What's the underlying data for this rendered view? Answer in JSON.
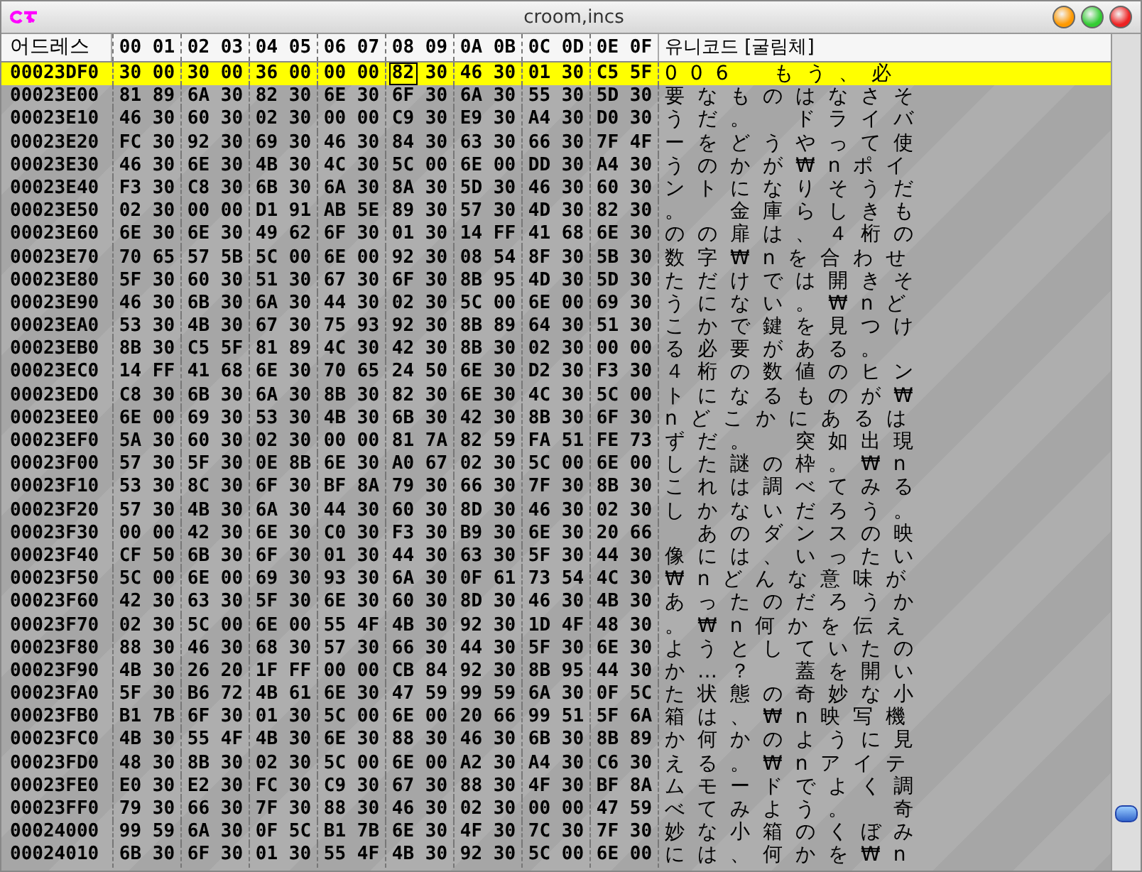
{
  "window": {
    "title": "croom,incs"
  },
  "columns": {
    "address": "어드레스",
    "bytes": [
      "00",
      "01",
      "02",
      "03",
      "04",
      "05",
      "06",
      "07",
      "08",
      "09",
      "0A",
      "0B",
      "0C",
      "0D",
      "0E",
      "0F"
    ],
    "text": "유니코드 [굴림체]"
  },
  "rows": [
    {
      "address": "00023DF0",
      "bytes": [
        "30",
        "00",
        "30",
        "00",
        "36",
        "00",
        "00",
        "00",
        "82",
        "30",
        "46",
        "30",
        "01",
        "30",
        "C5",
        "5F"
      ],
      "text": "006　もう、必",
      "selected": true,
      "cursor": [
        false,
        false,
        false,
        false,
        false,
        false,
        false,
        false,
        true,
        false,
        false,
        false,
        false,
        false,
        false,
        false
      ]
    },
    {
      "address": "00023E00",
      "bytes": [
        "81",
        "89",
        "6A",
        "30",
        "82",
        "30",
        "6E",
        "30",
        "6F",
        "30",
        "6A",
        "30",
        "55",
        "30",
        "5D",
        "30"
      ],
      "text": "要なものはなさそ",
      "selected": false
    },
    {
      "address": "00023E10",
      "bytes": [
        "46",
        "30",
        "60",
        "30",
        "02",
        "30",
        "00",
        "00",
        "C9",
        "30",
        "E9",
        "30",
        "A4",
        "30",
        "D0",
        "30"
      ],
      "text": "うだ。　ドライバ",
      "selected": false
    },
    {
      "address": "00023E20",
      "bytes": [
        "FC",
        "30",
        "92",
        "30",
        "69",
        "30",
        "46",
        "30",
        "84",
        "30",
        "63",
        "30",
        "66",
        "30",
        "7F",
        "4F"
      ],
      "text": "ーをどうやって使",
      "selected": false
    },
    {
      "address": "00023E30",
      "bytes": [
        "46",
        "30",
        "6E",
        "30",
        "4B",
        "30",
        "4C",
        "30",
        "5C",
        "00",
        "6E",
        "00",
        "DD",
        "30",
        "A4",
        "30"
      ],
      "text": "うのかが₩nポイ",
      "selected": false
    },
    {
      "address": "00023E40",
      "bytes": [
        "F3",
        "30",
        "C8",
        "30",
        "6B",
        "30",
        "6A",
        "30",
        "8A",
        "30",
        "5D",
        "30",
        "46",
        "30",
        "60",
        "30"
      ],
      "text": "ントになりそうだ",
      "selected": false
    },
    {
      "address": "00023E50",
      "bytes": [
        "02",
        "30",
        "00",
        "00",
        "D1",
        "91",
        "AB",
        "5E",
        "89",
        "30",
        "57",
        "30",
        "4D",
        "30",
        "82",
        "30"
      ],
      "text": "。　金庫らしきも",
      "selected": false
    },
    {
      "address": "00023E60",
      "bytes": [
        "6E",
        "30",
        "6E",
        "30",
        "49",
        "62",
        "6F",
        "30",
        "01",
        "30",
        "14",
        "FF",
        "41",
        "68",
        "6E",
        "30"
      ],
      "text": "のの扉は、４桁の",
      "selected": false
    },
    {
      "address": "00023E70",
      "bytes": [
        "70",
        "65",
        "57",
        "5B",
        "5C",
        "00",
        "6E",
        "00",
        "92",
        "30",
        "08",
        "54",
        "8F",
        "30",
        "5B",
        "30"
      ],
      "text": "数字₩nを合わせ",
      "selected": false
    },
    {
      "address": "00023E80",
      "bytes": [
        "5F",
        "30",
        "60",
        "30",
        "51",
        "30",
        "67",
        "30",
        "6F",
        "30",
        "8B",
        "95",
        "4D",
        "30",
        "5D",
        "30"
      ],
      "text": "ただけでは開きそ",
      "selected": false
    },
    {
      "address": "00023E90",
      "bytes": [
        "46",
        "30",
        "6B",
        "30",
        "6A",
        "30",
        "44",
        "30",
        "02",
        "30",
        "5C",
        "00",
        "6E",
        "00",
        "69",
        "30"
      ],
      "text": "うにない。₩nど",
      "selected": false
    },
    {
      "address": "00023EA0",
      "bytes": [
        "53",
        "30",
        "4B",
        "30",
        "67",
        "30",
        "75",
        "93",
        "92",
        "30",
        "8B",
        "89",
        "64",
        "30",
        "51",
        "30"
      ],
      "text": "こかで鍵を見つけ",
      "selected": false
    },
    {
      "address": "00023EB0",
      "bytes": [
        "8B",
        "30",
        "C5",
        "5F",
        "81",
        "89",
        "4C",
        "30",
        "42",
        "30",
        "8B",
        "30",
        "02",
        "30",
        "00",
        "00"
      ],
      "text": "る必要がある。",
      "selected": false
    },
    {
      "address": "00023EC0",
      "bytes": [
        "14",
        "FF",
        "41",
        "68",
        "6E",
        "30",
        "70",
        "65",
        "24",
        "50",
        "6E",
        "30",
        "D2",
        "30",
        "F3",
        "30"
      ],
      "text": "４桁の数値のヒン",
      "selected": false
    },
    {
      "address": "00023ED0",
      "bytes": [
        "C8",
        "30",
        "6B",
        "30",
        "6A",
        "30",
        "8B",
        "30",
        "82",
        "30",
        "6E",
        "30",
        "4C",
        "30",
        "5C",
        "00"
      ],
      "text": "トになるものが₩",
      "selected": false
    },
    {
      "address": "00023EE0",
      "bytes": [
        "6E",
        "00",
        "69",
        "30",
        "53",
        "30",
        "4B",
        "30",
        "6B",
        "30",
        "42",
        "30",
        "8B",
        "30",
        "6F",
        "30"
      ],
      "text": "nどこかにあるは",
      "selected": false
    },
    {
      "address": "00023EF0",
      "bytes": [
        "5A",
        "30",
        "60",
        "30",
        "02",
        "30",
        "00",
        "00",
        "81",
        "7A",
        "82",
        "59",
        "FA",
        "51",
        "FE",
        "73"
      ],
      "text": "ずだ。　突如出現",
      "selected": false
    },
    {
      "address": "00023F00",
      "bytes": [
        "57",
        "30",
        "5F",
        "30",
        "0E",
        "8B",
        "6E",
        "30",
        "A0",
        "67",
        "02",
        "30",
        "5C",
        "00",
        "6E",
        "00"
      ],
      "text": "した謎の枠。₩n",
      "selected": false
    },
    {
      "address": "00023F10",
      "bytes": [
        "53",
        "30",
        "8C",
        "30",
        "6F",
        "30",
        "BF",
        "8A",
        "79",
        "30",
        "66",
        "30",
        "7F",
        "30",
        "8B",
        "30"
      ],
      "text": "これは調べてみる",
      "selected": false
    },
    {
      "address": "00023F20",
      "bytes": [
        "57",
        "30",
        "4B",
        "30",
        "6A",
        "30",
        "44",
        "30",
        "60",
        "30",
        "8D",
        "30",
        "46",
        "30",
        "02",
        "30"
      ],
      "text": "しかないだろう。",
      "selected": false
    },
    {
      "address": "00023F30",
      "bytes": [
        "00",
        "00",
        "42",
        "30",
        "6E",
        "30",
        "C0",
        "30",
        "F3",
        "30",
        "B9",
        "30",
        "6E",
        "30",
        "20",
        "66"
      ],
      "text": "　あのダンスの映",
      "selected": false
    },
    {
      "address": "00023F40",
      "bytes": [
        "CF",
        "50",
        "6B",
        "30",
        "6F",
        "30",
        "01",
        "30",
        "44",
        "30",
        "63",
        "30",
        "5F",
        "30",
        "44",
        "30"
      ],
      "text": "像には、いったい",
      "selected": false
    },
    {
      "address": "00023F50",
      "bytes": [
        "5C",
        "00",
        "6E",
        "00",
        "69",
        "30",
        "93",
        "30",
        "6A",
        "30",
        "0F",
        "61",
        "73",
        "54",
        "4C",
        "30"
      ],
      "text": "₩nどんな意味が",
      "selected": false
    },
    {
      "address": "00023F60",
      "bytes": [
        "42",
        "30",
        "63",
        "30",
        "5F",
        "30",
        "6E",
        "30",
        "60",
        "30",
        "8D",
        "30",
        "46",
        "30",
        "4B",
        "30"
      ],
      "text": "あったのだろうか",
      "selected": false
    },
    {
      "address": "00023F70",
      "bytes": [
        "02",
        "30",
        "5C",
        "00",
        "6E",
        "00",
        "55",
        "4F",
        "4B",
        "30",
        "92",
        "30",
        "1D",
        "4F",
        "48",
        "30"
      ],
      "text": "。₩n何かを伝え",
      "selected": false
    },
    {
      "address": "00023F80",
      "bytes": [
        "88",
        "30",
        "46",
        "30",
        "68",
        "30",
        "57",
        "30",
        "66",
        "30",
        "44",
        "30",
        "5F",
        "30",
        "6E",
        "30"
      ],
      "text": "ようとしていたの",
      "selected": false
    },
    {
      "address": "00023F90",
      "bytes": [
        "4B",
        "30",
        "26",
        "20",
        "1F",
        "FF",
        "00",
        "00",
        "CB",
        "84",
        "92",
        "30",
        "8B",
        "95",
        "44",
        "30"
      ],
      "text": "か…？　蓋を開い",
      "selected": false
    },
    {
      "address": "00023FA0",
      "bytes": [
        "5F",
        "30",
        "B6",
        "72",
        "4B",
        "61",
        "6E",
        "30",
        "47",
        "59",
        "99",
        "59",
        "6A",
        "30",
        "0F",
        "5C"
      ],
      "text": "た状態の奇妙な小",
      "selected": false
    },
    {
      "address": "00023FB0",
      "bytes": [
        "B1",
        "7B",
        "6F",
        "30",
        "01",
        "30",
        "5C",
        "00",
        "6E",
        "00",
        "20",
        "66",
        "99",
        "51",
        "5F",
        "6A"
      ],
      "text": "箱は、₩n映写機",
      "selected": false
    },
    {
      "address": "00023FC0",
      "bytes": [
        "4B",
        "30",
        "55",
        "4F",
        "4B",
        "30",
        "6E",
        "30",
        "88",
        "30",
        "46",
        "30",
        "6B",
        "30",
        "8B",
        "89"
      ],
      "text": "か何かのように見",
      "selected": false
    },
    {
      "address": "00023FD0",
      "bytes": [
        "48",
        "30",
        "8B",
        "30",
        "02",
        "30",
        "5C",
        "00",
        "6E",
        "00",
        "A2",
        "30",
        "A4",
        "30",
        "C6",
        "30"
      ],
      "text": "える。₩nアイテ",
      "selected": false
    },
    {
      "address": "00023FE0",
      "bytes": [
        "E0",
        "30",
        "E2",
        "30",
        "FC",
        "30",
        "C9",
        "30",
        "67",
        "30",
        "88",
        "30",
        "4F",
        "30",
        "BF",
        "8A"
      ],
      "text": "ムモードでよく調",
      "selected": false
    },
    {
      "address": "00023FF0",
      "bytes": [
        "79",
        "30",
        "66",
        "30",
        "7F",
        "30",
        "88",
        "30",
        "46",
        "30",
        "02",
        "30",
        "00",
        "00",
        "47",
        "59"
      ],
      "text": "べてみよう。　奇",
      "selected": false
    },
    {
      "address": "00024000",
      "bytes": [
        "99",
        "59",
        "6A",
        "30",
        "0F",
        "5C",
        "B1",
        "7B",
        "6E",
        "30",
        "4F",
        "30",
        "7C",
        "30",
        "7F",
        "30"
      ],
      "text": "妙な小箱のくぼみ",
      "selected": false
    },
    {
      "address": "00024010",
      "bytes": [
        "6B",
        "30",
        "6F",
        "30",
        "01",
        "30",
        "55",
        "4F",
        "4B",
        "30",
        "92",
        "30",
        "5C",
        "00",
        "6E",
        "00"
      ],
      "text": "には、何かを₩n",
      "selected": false
    }
  ]
}
